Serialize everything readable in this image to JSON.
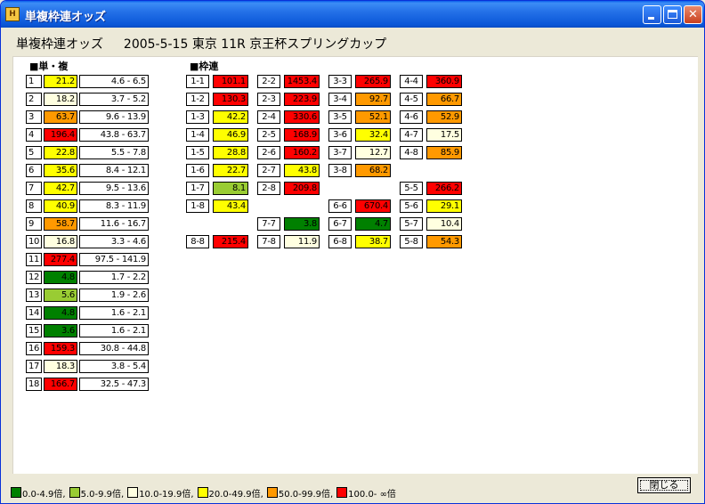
{
  "window": {
    "title": "単複枠連オッズ",
    "app_icon": "horse-racing-app-icon",
    "controls": {
      "minimize_icon": "minimize-icon",
      "maximize_icon": "maximize-icon",
      "close_icon": "close-icon"
    }
  },
  "header": {
    "title": "単複枠連オッズ",
    "date": "2005-5-15",
    "venue": "東京",
    "race": "11R",
    "race_name": "京王杯スプリングカップ"
  },
  "win_place": {
    "label": "■単・複",
    "rows": [
      {
        "no": "1",
        "win": "21.2",
        "place": "4.6 - 6.5",
        "color": "#FFFF00"
      },
      {
        "no": "2",
        "win": "18.2",
        "place": "3.7 - 5.2",
        "color": "#FFFFE0"
      },
      {
        "no": "3",
        "win": "63.7",
        "place": "9.6 - 13.9",
        "color": "#FF9900"
      },
      {
        "no": "4",
        "win": "196.4",
        "place": "43.8 - 63.7",
        "color": "#FF0000"
      },
      {
        "no": "5",
        "win": "22.8",
        "place": "5.5 - 7.8",
        "color": "#FFFF00"
      },
      {
        "no": "6",
        "win": "35.6",
        "place": "8.4 - 12.1",
        "color": "#FFFF00"
      },
      {
        "no": "7",
        "win": "42.7",
        "place": "9.5 - 13.6",
        "color": "#FFFF00"
      },
      {
        "no": "8",
        "win": "40.9",
        "place": "8.3 - 11.9",
        "color": "#FFFF00"
      },
      {
        "no": "9",
        "win": "58.7",
        "place": "11.6 - 16.7",
        "color": "#FF9900"
      },
      {
        "no": "10",
        "win": "16.8",
        "place": "3.3 - 4.6",
        "color": "#FFFFE0"
      },
      {
        "no": "11",
        "win": "277.4",
        "place": "97.5 - 141.9",
        "color": "#FF0000"
      },
      {
        "no": "12",
        "win": "4.8",
        "place": "1.7 - 2.2",
        "color": "#008000"
      },
      {
        "no": "13",
        "win": "5.6",
        "place": "1.9 - 2.6",
        "color": "#99CC33"
      },
      {
        "no": "14",
        "win": "4.8",
        "place": "1.6 - 2.1",
        "color": "#008000"
      },
      {
        "no": "15",
        "win": "3.6",
        "place": "1.6 - 2.1",
        "color": "#008000"
      },
      {
        "no": "16",
        "win": "159.3",
        "place": "30.8 - 44.8",
        "color": "#FF0000"
      },
      {
        "no": "17",
        "win": "18.3",
        "place": "3.8 - 5.4",
        "color": "#FFFFE0"
      },
      {
        "no": "18",
        "win": "166.7",
        "place": "32.5 - 47.3",
        "color": "#FF0000"
      }
    ]
  },
  "bracket": {
    "label": "■枠連",
    "cells": [
      {
        "pair": "1-1",
        "odds": "101.1",
        "col": 0,
        "row": 0,
        "color": "#FF0000"
      },
      {
        "pair": "1-2",
        "odds": "130.3",
        "col": 0,
        "row": 1,
        "color": "#FF0000"
      },
      {
        "pair": "1-3",
        "odds": "42.2",
        "col": 0,
        "row": 2,
        "color": "#FFFF00"
      },
      {
        "pair": "1-4",
        "odds": "46.9",
        "col": 0,
        "row": 3,
        "color": "#FFFF00"
      },
      {
        "pair": "1-5",
        "odds": "28.8",
        "col": 0,
        "row": 4,
        "color": "#FFFF00"
      },
      {
        "pair": "1-6",
        "odds": "22.7",
        "col": 0,
        "row": 5,
        "color": "#FFFF00"
      },
      {
        "pair": "1-7",
        "odds": "8.1",
        "col": 0,
        "row": 6,
        "color": "#99CC33"
      },
      {
        "pair": "1-8",
        "odds": "43.4",
        "col": 0,
        "row": 7,
        "color": "#FFFF00"
      },
      {
        "pair": "8-8",
        "odds": "215.4",
        "col": 0,
        "row": 9,
        "color": "#FF0000"
      },
      {
        "pair": "2-2",
        "odds": "1453.4",
        "col": 1,
        "row": 0,
        "color": "#FF0000"
      },
      {
        "pair": "2-3",
        "odds": "223.9",
        "col": 1,
        "row": 1,
        "color": "#FF0000"
      },
      {
        "pair": "2-4",
        "odds": "330.6",
        "col": 1,
        "row": 2,
        "color": "#FF0000"
      },
      {
        "pair": "2-5",
        "odds": "168.9",
        "col": 1,
        "row": 3,
        "color": "#FF0000"
      },
      {
        "pair": "2-6",
        "odds": "160.2",
        "col": 1,
        "row": 4,
        "color": "#FF0000"
      },
      {
        "pair": "2-7",
        "odds": "43.8",
        "col": 1,
        "row": 5,
        "color": "#FFFF00"
      },
      {
        "pair": "2-8",
        "odds": "209.8",
        "col": 1,
        "row": 6,
        "color": "#FF0000"
      },
      {
        "pair": "7-7",
        "odds": "3.8",
        "col": 1,
        "row": 8,
        "color": "#008000"
      },
      {
        "pair": "7-8",
        "odds": "11.9",
        "col": 1,
        "row": 9,
        "color": "#FFFFE0"
      },
      {
        "pair": "3-3",
        "odds": "265.9",
        "col": 2,
        "row": 0,
        "color": "#FF0000"
      },
      {
        "pair": "3-4",
        "odds": "92.7",
        "col": 2,
        "row": 1,
        "color": "#FF9900"
      },
      {
        "pair": "3-5",
        "odds": "52.1",
        "col": 2,
        "row": 2,
        "color": "#FF9900"
      },
      {
        "pair": "3-6",
        "odds": "32.4",
        "col": 2,
        "row": 3,
        "color": "#FFFF00"
      },
      {
        "pair": "3-7",
        "odds": "12.7",
        "col": 2,
        "row": 4,
        "color": "#FFFFE0"
      },
      {
        "pair": "3-8",
        "odds": "68.2",
        "col": 2,
        "row": 5,
        "color": "#FF9900"
      },
      {
        "pair": "6-6",
        "odds": "670.4",
        "col": 2,
        "row": 7,
        "color": "#FF0000"
      },
      {
        "pair": "6-7",
        "odds": "4.7",
        "col": 2,
        "row": 8,
        "color": "#008000"
      },
      {
        "pair": "6-8",
        "odds": "38.7",
        "col": 2,
        "row": 9,
        "color": "#FFFF00"
      },
      {
        "pair": "4-4",
        "odds": "360.9",
        "col": 3,
        "row": 0,
        "color": "#FF0000"
      },
      {
        "pair": "4-5",
        "odds": "66.7",
        "col": 3,
        "row": 1,
        "color": "#FF9900"
      },
      {
        "pair": "4-6",
        "odds": "52.9",
        "col": 3,
        "row": 2,
        "color": "#FF9900"
      },
      {
        "pair": "4-7",
        "odds": "17.5",
        "col": 3,
        "row": 3,
        "color": "#FFFFE0"
      },
      {
        "pair": "4-8",
        "odds": "85.9",
        "col": 3,
        "row": 4,
        "color": "#FF9900"
      },
      {
        "pair": "5-5",
        "odds": "266.2",
        "col": 3,
        "row": 6,
        "color": "#FF0000"
      },
      {
        "pair": "5-6",
        "odds": "29.1",
        "col": 3,
        "row": 7,
        "color": "#FFFF00"
      },
      {
        "pair": "5-7",
        "odds": "10.4",
        "col": 3,
        "row": 8,
        "color": "#FFFFE0"
      },
      {
        "pair": "5-8",
        "odds": "54.3",
        "col": 3,
        "row": 9,
        "color": "#FF9900"
      }
    ]
  },
  "legend": [
    {
      "label": "0.0-4.9倍,",
      "color": "#008000"
    },
    {
      "label": "5.0-9.9倍,",
      "color": "#99CC33"
    },
    {
      "label": "10.0-19.9倍,",
      "color": "#FFFFE0"
    },
    {
      "label": "20.0-49.9倍,",
      "color": "#FFFF00"
    },
    {
      "label": "50.0-99.9倍,",
      "color": "#FF9900"
    },
    {
      "label": "100.0- ∞倍",
      "color": "#FF0000"
    }
  ],
  "footer": {
    "close_label": "閉じる"
  }
}
